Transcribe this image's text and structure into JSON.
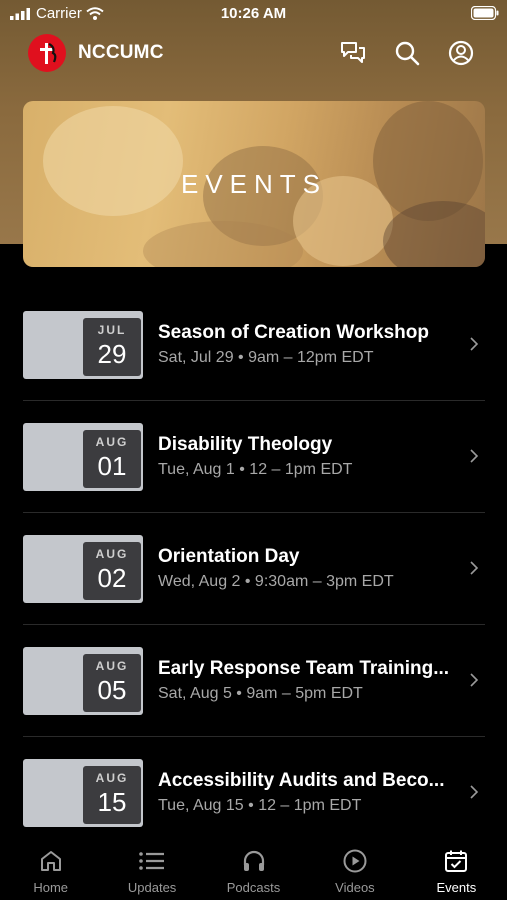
{
  "status": {
    "carrier": "Carrier",
    "time": "10:26 AM"
  },
  "header": {
    "title": "NCCUMC"
  },
  "hero": {
    "title": "EVENTS"
  },
  "events": [
    {
      "month": "JUL",
      "day": "29",
      "title": "Season of Creation Workshop",
      "meta": "Sat, Jul 29 • 9am – 12pm EDT"
    },
    {
      "month": "AUG",
      "day": "01",
      "title": "Disability Theology",
      "meta": "Tue, Aug 1 • 12 – 1pm EDT"
    },
    {
      "month": "AUG",
      "day": "02",
      "title": "Orientation Day",
      "meta": "Wed, Aug 2 • 9:30am – 3pm EDT"
    },
    {
      "month": "AUG",
      "day": "05",
      "title": "Early Response Team Training...",
      "meta": "Sat, Aug 5 • 9am – 5pm EDT"
    },
    {
      "month": "AUG",
      "day": "15",
      "title": "Accessibility Audits and Beco...",
      "meta": "Tue, Aug 15 • 12 – 1pm EDT"
    }
  ],
  "tabs": [
    {
      "label": "Home",
      "icon": "home-icon"
    },
    {
      "label": "Updates",
      "icon": "list-icon"
    },
    {
      "label": "Podcasts",
      "icon": "headphones-icon"
    },
    {
      "label": "Videos",
      "icon": "play-icon"
    },
    {
      "label": "Events",
      "icon": "calendar-icon"
    }
  ],
  "colors": {
    "brand_red": "#e0101e",
    "header_brown": "#7a5e35",
    "active_tab": "#ffffff"
  }
}
